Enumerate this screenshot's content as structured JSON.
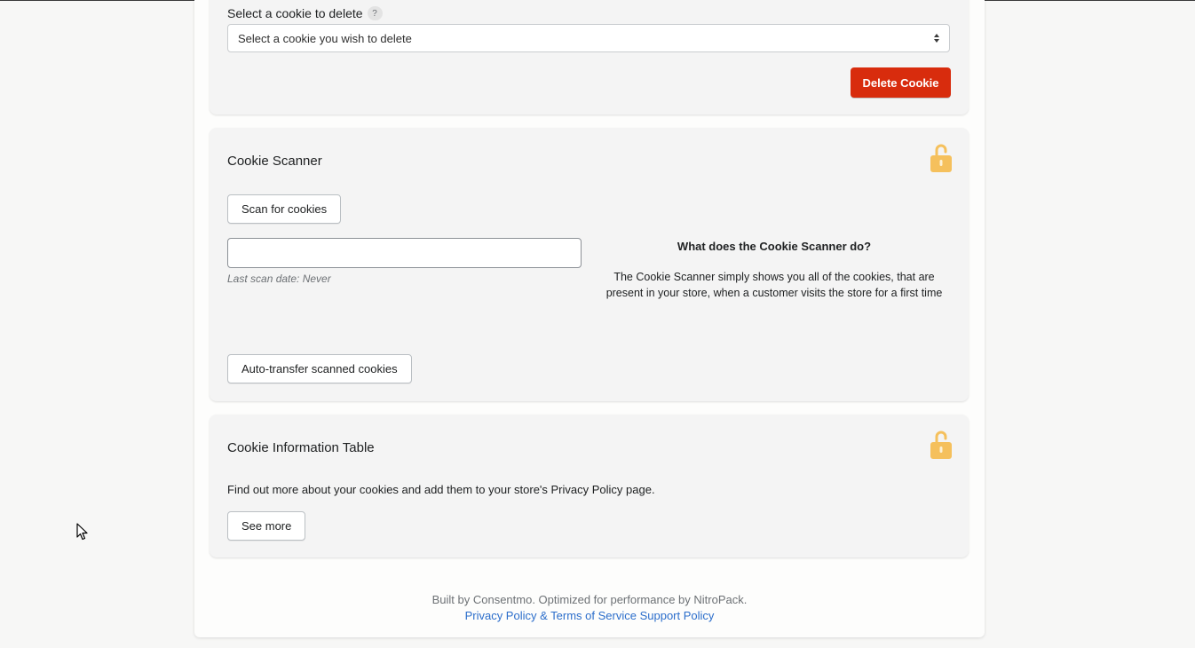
{
  "delete_section": {
    "label": "Select a cookie to delete",
    "help_icon": "?",
    "select_placeholder": "Select a cookie you wish to delete",
    "delete_button": "Delete Cookie"
  },
  "scanner": {
    "title": "Cookie Scanner",
    "lock_icon": "unlocked-padlock-icon",
    "scan_button": "Scan for cookies",
    "scan_input_value": "",
    "last_scan": "Last scan date: Never",
    "info_title": "What does the Cookie Scanner do?",
    "info_text": "The Cookie Scanner simply shows you all of the cookies, that are present in your store, when a customer visits the store for a first time",
    "auto_transfer_button": "Auto-transfer scanned cookies"
  },
  "info_table": {
    "title": "Cookie Information Table",
    "lock_icon": "unlocked-padlock-icon",
    "description": "Find out more about your cookies and add them to your store's Privacy Policy page.",
    "see_more_button": "See more"
  },
  "footer": {
    "text": "Built by Consentmo. Optimized for performance by NitroPack.",
    "links": [
      "Privacy Policy & Terms of Service",
      "Support Policy"
    ]
  },
  "colors": {
    "danger": "#d82c0d",
    "lock": "#f5c05c",
    "link": "#2c6ecb"
  }
}
